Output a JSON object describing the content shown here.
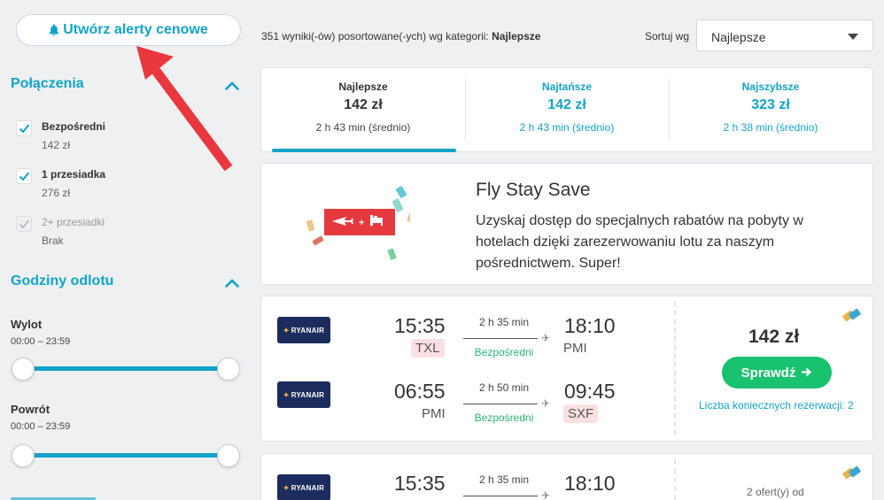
{
  "sidebar": {
    "alert_button": "Utwórz alerty cenowe",
    "connections_title": "Połączenia",
    "stops": [
      {
        "label": "Bezpośredni",
        "price": "142 zł",
        "checked": true,
        "disabled": false
      },
      {
        "label": "1 przesiadka",
        "price": "276 zł",
        "checked": true,
        "disabled": false
      },
      {
        "label": "2+ przesiadki",
        "price": "Brak",
        "checked": true,
        "disabled": true
      }
    ],
    "departure_title": "Godziny odlotu",
    "outbound": {
      "label": "Wylot",
      "range": "00:00 – 23:59"
    },
    "return": {
      "label": "Powrót",
      "range": "00:00 – 23:59"
    }
  },
  "topbar": {
    "results_prefix": "351 wyniki(-ów) posortowane(-ych) wg kategorii: ",
    "results_category": "Najlepsze",
    "sort_label": "Sortuj wg",
    "sort_value": "Najlepsze"
  },
  "tabs": [
    {
      "name": "Najlepsze",
      "price": "142 zł",
      "time": "2 h 43 min (średnio)",
      "active": true
    },
    {
      "name": "Najtańsze",
      "price": "142 zł",
      "time": "2 h 43 min (średnio)",
      "active": false
    },
    {
      "name": "Najszybsze",
      "price": "323 zł",
      "time": "2 h 38 min (średnio)",
      "active": false
    }
  ],
  "promo": {
    "title": "Fly Stay Save",
    "text": "Uzyskaj dostęp do specjalnych rabatów na pobyty w hotelach dzięki zarezerwowaniu lotu za naszym pośrednictwem. Super!"
  },
  "results": [
    {
      "airline": "RYANAIR",
      "legs": [
        {
          "dep_time": "15:35",
          "dep_airport": "TXL",
          "duration": "2 h 35 min",
          "stops": "Bezpośredni",
          "arr_time": "18:10",
          "arr_airport": "PMI"
        },
        {
          "dep_time": "06:55",
          "dep_airport": "PMI",
          "duration": "2 h 50 min",
          "stops": "Bezpośredni",
          "arr_time": "09:45",
          "arr_airport": "SXF"
        }
      ],
      "price": "142 zł",
      "button": "Sprawdź",
      "bookings": "Liczba koniecznych rezerwacji: 2"
    },
    {
      "airline": "RYANAIR",
      "legs": [
        {
          "dep_time": "15:35",
          "duration": "2 h 35 min",
          "arr_time": "18:10"
        }
      ],
      "offers": "2 ofert(y) od"
    }
  ],
  "colors": {
    "accent": "#13a3c8",
    "green": "#19c26e",
    "warn_bg": "#fbe0e1",
    "arrow": "#e8383d"
  }
}
